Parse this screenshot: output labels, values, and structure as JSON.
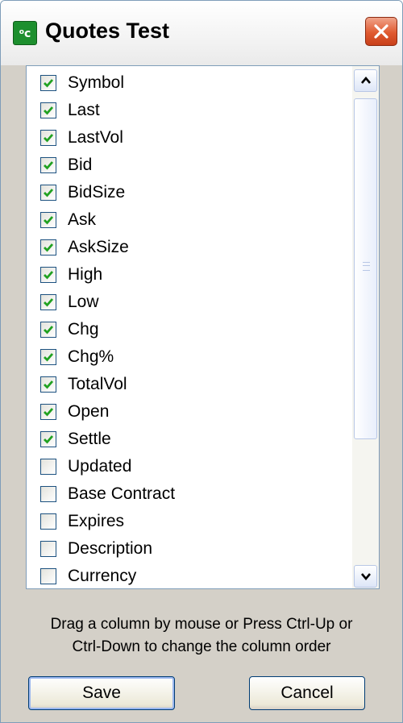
{
  "window": {
    "title": "Quotes Test",
    "icon": "oc-app-icon"
  },
  "columns": [
    {
      "label": "Symbol",
      "checked": true
    },
    {
      "label": "Last",
      "checked": true
    },
    {
      "label": "LastVol",
      "checked": true
    },
    {
      "label": "Bid",
      "checked": true
    },
    {
      "label": "BidSize",
      "checked": true
    },
    {
      "label": "Ask",
      "checked": true
    },
    {
      "label": "AskSize",
      "checked": true
    },
    {
      "label": "High",
      "checked": true
    },
    {
      "label": "Low",
      "checked": true
    },
    {
      "label": "Chg",
      "checked": true
    },
    {
      "label": "Chg%",
      "checked": true
    },
    {
      "label": "TotalVol",
      "checked": true
    },
    {
      "label": "Open",
      "checked": true
    },
    {
      "label": "Settle",
      "checked": true
    },
    {
      "label": "Updated",
      "checked": false
    },
    {
      "label": "Base Contract",
      "checked": false
    },
    {
      "label": "Expires",
      "checked": false
    },
    {
      "label": "Description",
      "checked": false
    },
    {
      "label": "Currency",
      "checked": false
    }
  ],
  "hint": {
    "line1": "Drag a column by mouse or Press Ctrl-Up or",
    "line2": "Ctrl-Down to change the column order"
  },
  "buttons": {
    "save": "Save",
    "cancel": "Cancel"
  },
  "colors": {
    "check": "#21a121",
    "close_button": "#e05a30",
    "accent_border": "#7f9db9"
  }
}
